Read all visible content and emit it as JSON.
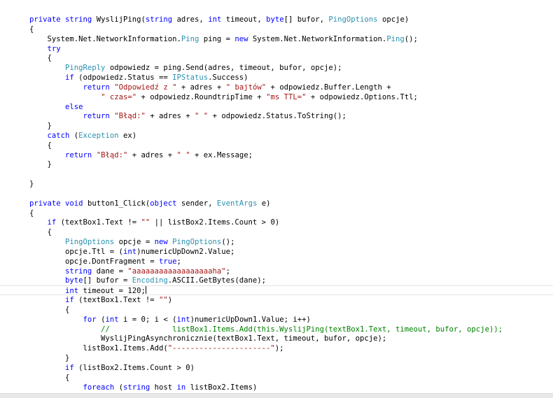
{
  "editor": {
    "language": "C#",
    "token_colors": {
      "keyword": "#0000ff",
      "type": "#2b91af",
      "string": "#a31515",
      "comment": "#008000",
      "plain": "#000000"
    },
    "current_line_index": 28,
    "lines": [
      [
        [
          "kw",
          "private"
        ],
        [
          "pl",
          " "
        ],
        [
          "kw",
          "string"
        ],
        [
          "pl",
          " WyslijPing("
        ],
        [
          "kw",
          "string"
        ],
        [
          "pl",
          " adres, "
        ],
        [
          "kw",
          "int"
        ],
        [
          "pl",
          " timeout, "
        ],
        [
          "kw",
          "byte"
        ],
        [
          "pl",
          "[] bufor, "
        ],
        [
          "ty",
          "PingOptions"
        ],
        [
          "pl",
          " opcje)"
        ]
      ],
      [
        [
          "pl",
          "{"
        ]
      ],
      [
        [
          "pl",
          "    System.Net.NetworkInformation."
        ],
        [
          "ty",
          "Ping"
        ],
        [
          "pl",
          " ping = "
        ],
        [
          "kw",
          "new"
        ],
        [
          "pl",
          " System.Net.NetworkInformation."
        ],
        [
          "ty",
          "Ping"
        ],
        [
          "pl",
          "();"
        ]
      ],
      [
        [
          "pl",
          "    "
        ],
        [
          "kw",
          "try"
        ]
      ],
      [
        [
          "pl",
          "    {"
        ]
      ],
      [
        [
          "pl",
          "        "
        ],
        [
          "ty",
          "PingReply"
        ],
        [
          "pl",
          " odpowiedz = ping.Send(adres, timeout, bufor, opcje);"
        ]
      ],
      [
        [
          "pl",
          "        "
        ],
        [
          "kw",
          "if"
        ],
        [
          "pl",
          " (odpowiedz.Status == "
        ],
        [
          "ty",
          "IPStatus"
        ],
        [
          "pl",
          ".Success)"
        ]
      ],
      [
        [
          "pl",
          "            "
        ],
        [
          "kw",
          "return"
        ],
        [
          "pl",
          " "
        ],
        [
          "st",
          "\"Odpowiedź z \""
        ],
        [
          "pl",
          " + adres + "
        ],
        [
          "st",
          "\" bajtów\""
        ],
        [
          "pl",
          " + odpowiedz.Buffer.Length +"
        ]
      ],
      [
        [
          "pl",
          "                "
        ],
        [
          "st",
          "\" czas=\""
        ],
        [
          "pl",
          " + odpowiedz.RoundtripTime + "
        ],
        [
          "st",
          "\"ms TTL=\""
        ],
        [
          "pl",
          " + odpowiedz.Options.Ttl;"
        ]
      ],
      [
        [
          "pl",
          "        "
        ],
        [
          "kw",
          "else"
        ]
      ],
      [
        [
          "pl",
          "            "
        ],
        [
          "kw",
          "return"
        ],
        [
          "pl",
          " "
        ],
        [
          "st",
          "\"Błąd:\""
        ],
        [
          "pl",
          " + adres + "
        ],
        [
          "st",
          "\" \""
        ],
        [
          "pl",
          " + odpowiedz.Status.ToString();"
        ]
      ],
      [
        [
          "pl",
          "    }"
        ]
      ],
      [
        [
          "pl",
          "    "
        ],
        [
          "kw",
          "catch"
        ],
        [
          "pl",
          " ("
        ],
        [
          "ty",
          "Exception"
        ],
        [
          "pl",
          " ex)"
        ]
      ],
      [
        [
          "pl",
          "    {"
        ]
      ],
      [
        [
          "pl",
          "        "
        ],
        [
          "kw",
          "return"
        ],
        [
          "pl",
          " "
        ],
        [
          "st",
          "\"Błąd:\""
        ],
        [
          "pl",
          " + adres + "
        ],
        [
          "st",
          "\" \""
        ],
        [
          "pl",
          " + ex.Message;"
        ]
      ],
      [
        [
          "pl",
          "    }"
        ]
      ],
      [],
      [
        [
          "pl",
          "}"
        ]
      ],
      [],
      [
        [
          "kw",
          "private"
        ],
        [
          "pl",
          " "
        ],
        [
          "kw",
          "void"
        ],
        [
          "pl",
          " button1_Click("
        ],
        [
          "kw",
          "object"
        ],
        [
          "pl",
          " sender, "
        ],
        [
          "ty",
          "EventArgs"
        ],
        [
          "pl",
          " e)"
        ]
      ],
      [
        [
          "pl",
          "{"
        ]
      ],
      [
        [
          "pl",
          "    "
        ],
        [
          "kw",
          "if"
        ],
        [
          "pl",
          " (textBox1.Text != "
        ],
        [
          "st",
          "\"\""
        ],
        [
          "pl",
          " || listBox2.Items.Count > 0)"
        ]
      ],
      [
        [
          "pl",
          "    {"
        ]
      ],
      [
        [
          "pl",
          "        "
        ],
        [
          "ty",
          "PingOptions"
        ],
        [
          "pl",
          " opcje = "
        ],
        [
          "kw",
          "new"
        ],
        [
          "pl",
          " "
        ],
        [
          "ty",
          "PingOptions"
        ],
        [
          "pl",
          "();"
        ]
      ],
      [
        [
          "pl",
          "        opcje.Ttl = ("
        ],
        [
          "kw",
          "int"
        ],
        [
          "pl",
          ")numericUpDown2.Value;"
        ]
      ],
      [
        [
          "pl",
          "        opcje.DontFragment = "
        ],
        [
          "kw",
          "true"
        ],
        [
          "pl",
          ";"
        ]
      ],
      [
        [
          "pl",
          "        "
        ],
        [
          "kw",
          "string"
        ],
        [
          "pl",
          " dane = "
        ],
        [
          "st",
          "\"aaaaaaaaaaaaaaaaaaha\""
        ],
        [
          "pl",
          ";"
        ]
      ],
      [
        [
          "pl",
          "        "
        ],
        [
          "kw",
          "byte"
        ],
        [
          "pl",
          "[] bufor = "
        ],
        [
          "ty",
          "Encoding"
        ],
        [
          "pl",
          ".ASCII.GetBytes(dane);"
        ]
      ],
      [
        [
          "pl",
          "        "
        ],
        [
          "kw",
          "int"
        ],
        [
          "pl",
          " timeout = 120;"
        ]
      ],
      [
        [
          "pl",
          "        "
        ],
        [
          "kw",
          "if"
        ],
        [
          "pl",
          " (textBox1.Text != "
        ],
        [
          "st",
          "\"\""
        ],
        [
          "pl",
          ")"
        ]
      ],
      [
        [
          "pl",
          "        {"
        ]
      ],
      [
        [
          "pl",
          "            "
        ],
        [
          "kw",
          "for"
        ],
        [
          "pl",
          " ("
        ],
        [
          "kw",
          "int"
        ],
        [
          "pl",
          " i = 0; i < ("
        ],
        [
          "kw",
          "int"
        ],
        [
          "pl",
          ")numericUpDown1.Value; i++)"
        ]
      ],
      [
        [
          "pl",
          "                "
        ],
        [
          "cm",
          "//              listBox1.Items.Add(this.WyslijPing(textBox1.Text, timeout, bufor, opcje));"
        ]
      ],
      [
        [
          "pl",
          "                WyslijPingAsynchronicznie(textBox1.Text, timeout, bufor, opcje);"
        ]
      ],
      [
        [
          "pl",
          "            listBox1.Items.Add("
        ],
        [
          "st",
          "\"----------------------\""
        ],
        [
          "pl",
          ");"
        ]
      ],
      [
        [
          "pl",
          "        }"
        ]
      ],
      [
        [
          "pl",
          "        "
        ],
        [
          "kw",
          "if"
        ],
        [
          "pl",
          " (listBox2.Items.Count > 0)"
        ]
      ],
      [
        [
          "pl",
          "        {"
        ]
      ],
      [
        [
          "pl",
          "            "
        ],
        [
          "kw",
          "foreach"
        ],
        [
          "pl",
          " ("
        ],
        [
          "kw",
          "string"
        ],
        [
          "pl",
          " host "
        ],
        [
          "kw",
          "in"
        ],
        [
          "pl",
          " listBox2.Items)"
        ]
      ]
    ]
  }
}
